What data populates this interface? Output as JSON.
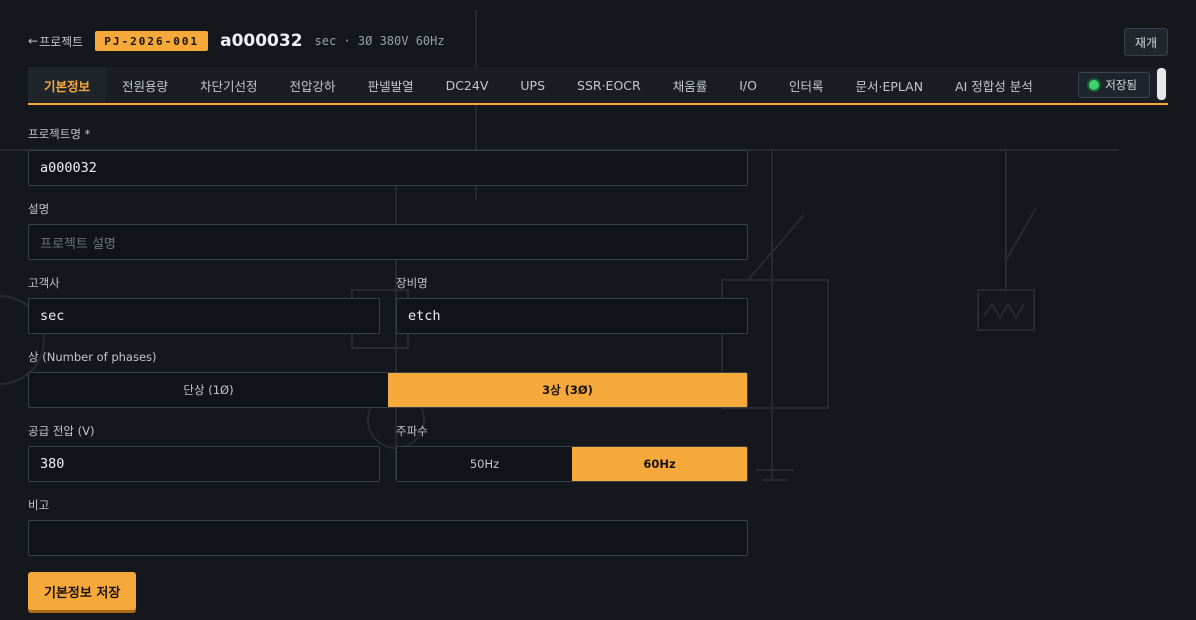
{
  "header": {
    "back_arrow": "←",
    "back_label": "프로젝트",
    "project_code": "PJ-2026-001",
    "project_name": "a000032",
    "project_meta": "sec · 3Ø 380V 60Hz",
    "load_button": "재개"
  },
  "tabs": [
    {
      "label": "기본정보",
      "active": true
    },
    {
      "label": "전원용량"
    },
    {
      "label": "차단기선정"
    },
    {
      "label": "전압강하"
    },
    {
      "label": "판넬발열"
    },
    {
      "label": "DC24V"
    },
    {
      "label": "UPS"
    },
    {
      "label": "SSR·EOCR"
    },
    {
      "label": "채움률"
    },
    {
      "label": "I/O"
    },
    {
      "label": "인터록"
    },
    {
      "label": "문서·EPLAN"
    },
    {
      "label": "AI 정합성 분석"
    }
  ],
  "status": {
    "saved_label": "저장됨",
    "indicator_icon": "green-dot-icon",
    "color": "#3cd36a"
  },
  "form": {
    "project_name_label": "프로젝트명 *",
    "project_name_value": "a000032",
    "description_label": "설명",
    "description_placeholder": "프로젝트 설명",
    "customer_label": "고객사",
    "customer_value": "sec",
    "equipment_label": "장비명",
    "equipment_value": "etch",
    "phase_label": "상 (Number of phases)",
    "phase_options": [
      "단상 (1Ø)",
      "3상 (3Ø)"
    ],
    "phase_selected": "3상 (3Ø)",
    "voltage_label": "공급 전압 (V)",
    "voltage_value": "380",
    "frequency_label": "주파수",
    "frequency_options": [
      "50Hz",
      "60Hz"
    ],
    "frequency_selected": "60Hz",
    "notes_label": "비고",
    "notes_value": "",
    "save_button": "기본정보 저장"
  },
  "colors": {
    "accent": "#f6a93b",
    "background": "#14171b",
    "status_ok": "#3cd36a"
  }
}
